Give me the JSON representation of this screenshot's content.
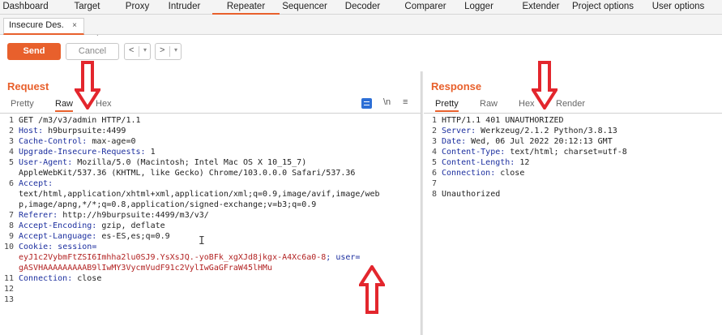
{
  "nav": {
    "tabs": [
      {
        "label": "Dashboard",
        "active": false
      },
      {
        "label": "Target",
        "active": false
      },
      {
        "label": "Proxy",
        "active": false
      },
      {
        "label": "Intruder",
        "active": false
      },
      {
        "label": "Repeater",
        "active": true
      },
      {
        "label": "Sequencer",
        "active": false
      },
      {
        "label": "Decoder",
        "active": false
      },
      {
        "label": "Comparer",
        "active": false
      },
      {
        "label": "Logger",
        "active": false
      },
      {
        "label": "Extender",
        "active": false
      },
      {
        "label": "Project options",
        "active": false
      },
      {
        "label": "User options",
        "active": false
      }
    ]
  },
  "subtab": {
    "label": "Insecure Des.",
    "close": "×",
    "add": "+"
  },
  "toolbar": {
    "send": "Send",
    "cancel": "Cancel",
    "prev": "<",
    "next": ">",
    "drop": "▾"
  },
  "request": {
    "title": "Request",
    "tabs": [
      "Pretty",
      "Raw",
      "Hex"
    ],
    "active_tab": "Raw",
    "newline_toggle": "\\n",
    "menu_icon": "≡",
    "lines": [
      {
        "n": "1",
        "parts": [
          {
            "t": "GET /m3/v3/admin HTTP/1.1",
            "c": "val"
          }
        ]
      },
      {
        "n": "2",
        "parts": [
          {
            "t": "Host: ",
            "c": "hdr"
          },
          {
            "t": "h9burpsuite:4499",
            "c": "val"
          }
        ]
      },
      {
        "n": "3",
        "parts": [
          {
            "t": "Cache-Control: ",
            "c": "hdr"
          },
          {
            "t": "max-age=0",
            "c": "val"
          }
        ]
      },
      {
        "n": "4",
        "parts": [
          {
            "t": "Upgrade-Insecure-Requests: ",
            "c": "hdr"
          },
          {
            "t": "1",
            "c": "val"
          }
        ]
      },
      {
        "n": "5",
        "parts": [
          {
            "t": "User-Agent: ",
            "c": "hdr"
          },
          {
            "t": "Mozilla/5.0 (Macintosh; Intel Mac OS X 10_15_7)",
            "c": "val"
          }
        ]
      },
      {
        "n": "",
        "parts": [
          {
            "t": "AppleWebKit/537.36 (KHTML, like Gecko) Chrome/103.0.0.0 Safari/537.36",
            "c": "val"
          }
        ]
      },
      {
        "n": "6",
        "parts": [
          {
            "t": "Accept:",
            "c": "hdr"
          }
        ]
      },
      {
        "n": "",
        "parts": [
          {
            "t": "text/html,application/xhtml+xml,application/xml;q=0.9,image/avif,image/web",
            "c": "val"
          }
        ]
      },
      {
        "n": "",
        "parts": [
          {
            "t": "p,image/apng,*/*;q=0.8,application/signed-exchange;v=b3;q=0.9",
            "c": "val"
          }
        ]
      },
      {
        "n": "7",
        "parts": [
          {
            "t": "Referer: ",
            "c": "hdr"
          },
          {
            "t": "http://h9burpsuite:4499/m3/v3/",
            "c": "val"
          }
        ]
      },
      {
        "n": "8",
        "parts": [
          {
            "t": "Accept-Encoding: ",
            "c": "hdr"
          },
          {
            "t": "gzip, deflate",
            "c": "val"
          }
        ]
      },
      {
        "n": "9",
        "parts": [
          {
            "t": "Accept-Language: ",
            "c": "hdr"
          },
          {
            "t": "es-ES,es;q=0.9",
            "c": "val"
          }
        ]
      },
      {
        "n": "10",
        "parts": [
          {
            "t": "Cookie: ",
            "c": "hdr"
          },
          {
            "t": "session=",
            "c": "hdr"
          }
        ]
      },
      {
        "n": "",
        "parts": [
          {
            "t": "eyJ1c2VybmFtZSI6Imhha2lu0SJ9.YsXsJQ.-yoBFk_xgXJd8jkgx-A4Xc6a0-8",
            "c": "ck"
          },
          {
            "t": "; user=",
            "c": "hdr"
          }
        ]
      },
      {
        "n": "",
        "parts": [
          {
            "t": "gASVHAAAAAAAAAB9lIwMY3VycmVudF91c2VylIwGaGFraW45lHMu",
            "c": "ck"
          }
        ]
      },
      {
        "n": "11",
        "parts": [
          {
            "t": "Connection: ",
            "c": "hdr"
          },
          {
            "t": "close",
            "c": "val"
          }
        ]
      },
      {
        "n": "12",
        "parts": []
      },
      {
        "n": "13",
        "parts": []
      }
    ]
  },
  "response": {
    "title": "Response",
    "tabs": [
      "Pretty",
      "Raw",
      "Hex",
      "Render"
    ],
    "active_tab": "Pretty",
    "lines": [
      {
        "n": "1",
        "parts": [
          {
            "t": "HTTP/1.1 401 UNAUTHORIZED",
            "c": "val"
          }
        ]
      },
      {
        "n": "2",
        "parts": [
          {
            "t": "Server: ",
            "c": "hdr"
          },
          {
            "t": "Werkzeug/2.1.2 Python/3.8.13",
            "c": "val"
          }
        ]
      },
      {
        "n": "3",
        "parts": [
          {
            "t": "Date: ",
            "c": "hdr"
          },
          {
            "t": "Wed, 06 Jul 2022 20:12:13 GMT",
            "c": "val"
          }
        ]
      },
      {
        "n": "4",
        "parts": [
          {
            "t": "Content-Type: ",
            "c": "hdr"
          },
          {
            "t": "text/html; charset=utf-8",
            "c": "val"
          }
        ]
      },
      {
        "n": "5",
        "parts": [
          {
            "t": "Content-Length: ",
            "c": "hdr"
          },
          {
            "t": "12",
            "c": "val"
          }
        ]
      },
      {
        "n": "6",
        "parts": [
          {
            "t": "Connection: ",
            "c": "hdr"
          },
          {
            "t": "close",
            "c": "val"
          }
        ]
      },
      {
        "n": "7",
        "parts": []
      },
      {
        "n": "8",
        "parts": [
          {
            "t": "Unauthorized",
            "c": "val"
          }
        ]
      }
    ]
  },
  "colors": {
    "accent": "#e8602c",
    "annotation": "#e3262d",
    "header": "#1c2f9f",
    "cookie": "#b22222"
  }
}
